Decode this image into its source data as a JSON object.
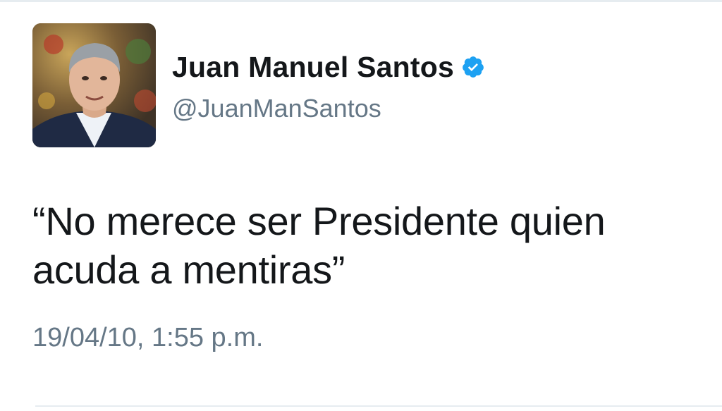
{
  "user": {
    "display_name": "Juan Manuel Santos",
    "handle": "@JuanManSantos",
    "verified_icon": "verified-badge-icon",
    "avatar_alt": "profile photo"
  },
  "tweet": {
    "text": "“No merece ser Presidente quien acuda a mentiras”",
    "timestamp": "19/04/10, 1:55 p.m."
  },
  "colors": {
    "text_primary": "#14171a",
    "text_secondary": "#657786",
    "verified_blue": "#1da1f2",
    "divider": "#e6ecf0"
  }
}
